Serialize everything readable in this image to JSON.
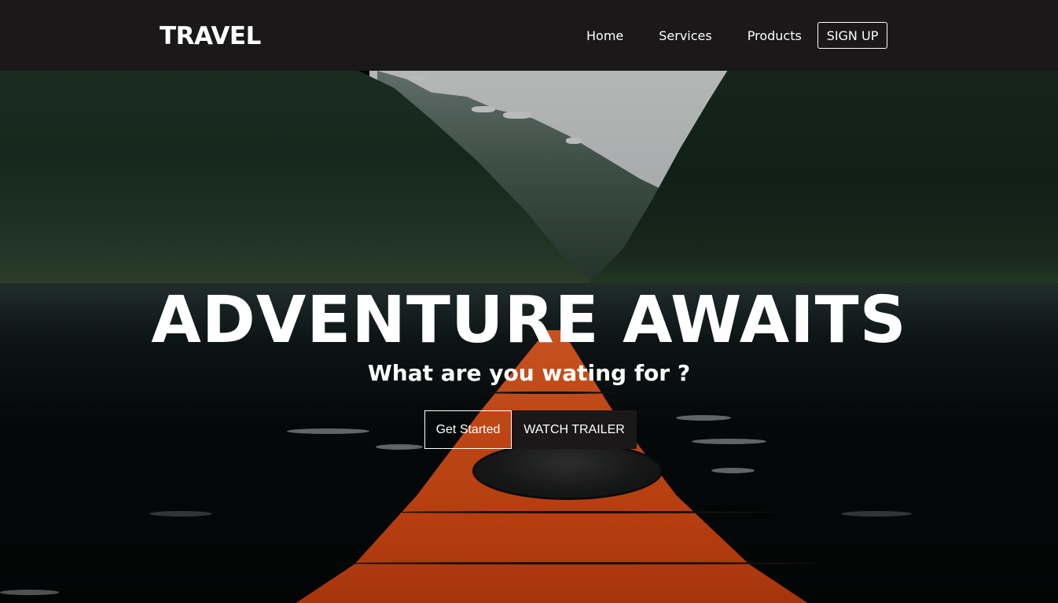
{
  "nav": {
    "brand": "TRAVEL",
    "links": [
      "Home",
      "Services",
      "Products"
    ],
    "signup_label": "SIGN UP"
  },
  "hero": {
    "title": "ADVENTURE AWAITS",
    "subtitle": "What are you wating for ?",
    "primary_cta": "Get Started",
    "secondary_cta": "WATCH TRAILER",
    "background_image": "kayak-in-fjord-photo"
  },
  "colors": {
    "navbar_bg": "#1b1819",
    "text": "#ffffff",
    "kayak_orange": "#f35a1c"
  }
}
